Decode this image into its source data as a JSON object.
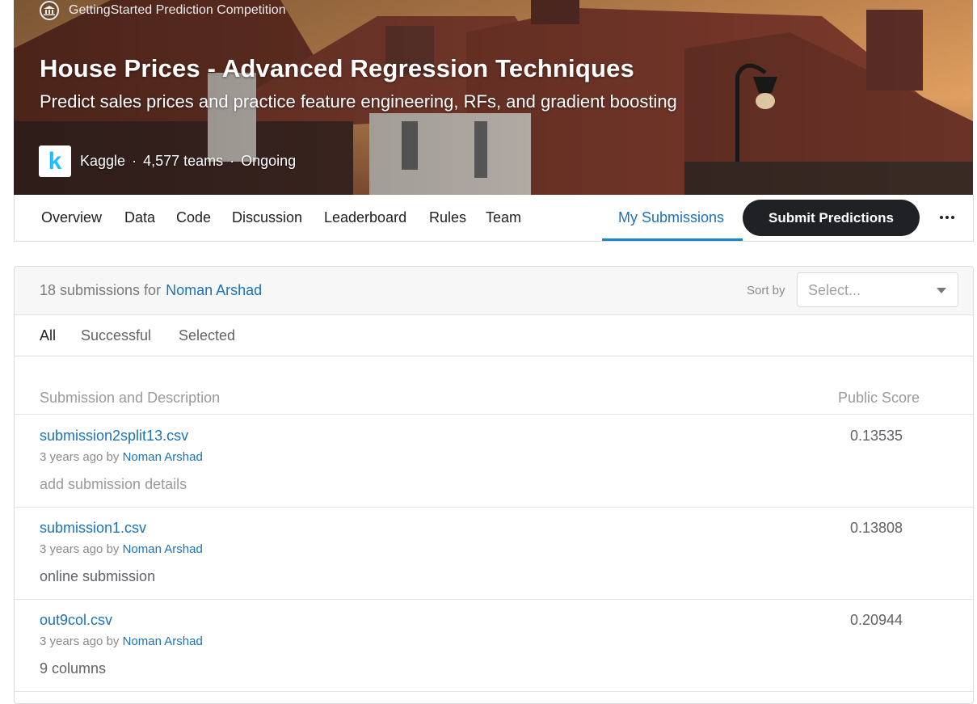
{
  "hero": {
    "competition_type": "GettingStarted Prediction Competition",
    "title": "House Prices - Advanced Regression Techniques",
    "subtitle": "Predict sales prices and practice feature engineering, RFs, and gradient boosting",
    "host": "Kaggle",
    "teams": "4,577 teams",
    "status": "Ongoing",
    "separator": "·",
    "logo_letter": "k"
  },
  "nav": {
    "tabs": [
      {
        "label": "Overview"
      },
      {
        "label": "Data"
      },
      {
        "label": "Code"
      },
      {
        "label": "Discussion"
      },
      {
        "label": "Leaderboard"
      },
      {
        "label": "Rules"
      },
      {
        "label": "Team"
      }
    ],
    "active_tab": "My Submissions",
    "submit_label": "Submit Predictions"
  },
  "submissions": {
    "count_text": "18 submissions for",
    "user": "Noman Arshad",
    "sort_label": "Sort by",
    "sort_placeholder": "Select...",
    "filters": [
      {
        "label": "All",
        "active": true
      },
      {
        "label": "Successful",
        "active": false
      },
      {
        "label": "Selected",
        "active": false
      }
    ],
    "columns": {
      "description": "Submission and Description",
      "score": "Public Score"
    },
    "rows": [
      {
        "file": "submission2split13.csv",
        "time": "3 years ago",
        "by": "by",
        "author": "Noman Arshad",
        "description": "add submission details",
        "score": "0.13535"
      },
      {
        "file": "submission1.csv",
        "time": "3 years ago",
        "by": "by",
        "author": "Noman Arshad",
        "description": "online submission",
        "score": "0.13808"
      },
      {
        "file": "out9col.csv",
        "time": "3 years ago",
        "by": "by",
        "author": "Noman Arshad",
        "description": "9 columns",
        "score": "0.20944"
      }
    ]
  },
  "colors": {
    "link": "#1a73b8",
    "active_underline": "#1a86c7",
    "button_bg": "#202124",
    "kaggle_blue": "#20beff"
  }
}
